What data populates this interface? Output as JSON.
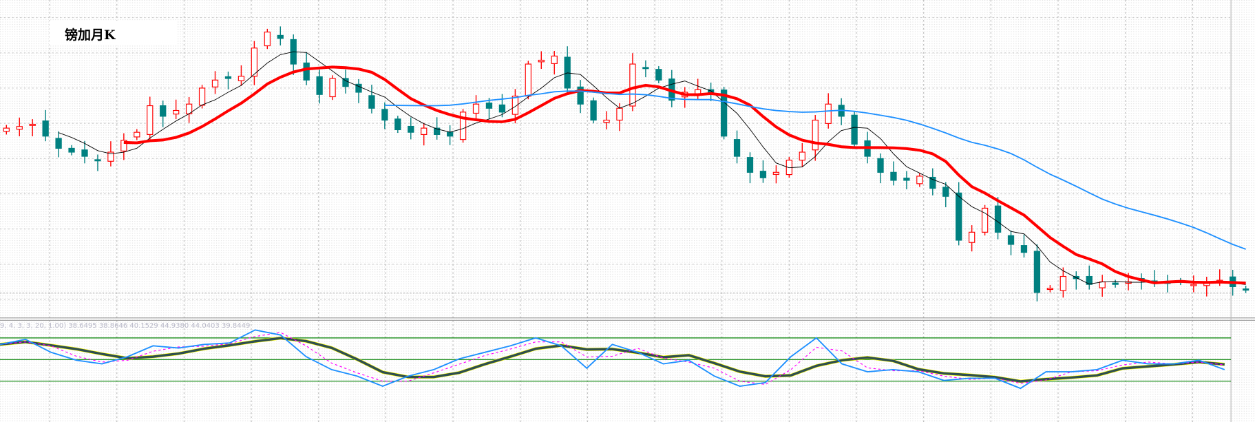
{
  "chart_data": {
    "type": "candlestick",
    "title": "镑加月K",
    "grid": true,
    "colors": {
      "up": "#ff0000",
      "down": "#008080",
      "ma_fast": "#000000",
      "ma_mid": "#ff0000",
      "ma_slow": "#1e90ff",
      "osc_fast": "#1e90ff",
      "osc_signal": "#ff00ff",
      "osc_slow": "#2f4f4f",
      "osc_slow_edge": "#ffff00",
      "levels": "#008000"
    },
    "closes": [
      60,
      60.5,
      61.2,
      57.5,
      53.7,
      52.5,
      51.2,
      50,
      52.5,
      56.2,
      58.7,
      67,
      63.7,
      65.5,
      67.5,
      72.5,
      75,
      75.5,
      76.2,
      85,
      90,
      88,
      80,
      75,
      70.5,
      75.5,
      73,
      71.2,
      66.2,
      62.5,
      59.5,
      58.7,
      60,
      58,
      57.5,
      65,
      67.5,
      66.2,
      65,
      70,
      80,
      81.2,
      82.5,
      72.5,
      67.5,
      62.5,
      62.5,
      66.2,
      80,
      78.7,
      75,
      68.7,
      71.2,
      72,
      71.2,
      57.5,
      51.2,
      46.2,
      44.5,
      46.2,
      50,
      52.5,
      62.5,
      67.5,
      63.7,
      55,
      51.2,
      46.2,
      43.7,
      43.7,
      45,
      41.2,
      38.7,
      25,
      27.5,
      35,
      27.5,
      23.7,
      21.2,
      8.7,
      10,
      13.7,
      13,
      11.2,
      12,
      11.2,
      12,
      13,
      12,
      11.5,
      12,
      11.2,
      12,
      12.5,
      10.5,
      9.5
    ],
    "moving_averages": [
      5,
      10,
      20,
      60
    ],
    "indicator": {
      "label": "9, 4, 3, 3, 20, 1.00) 38.6495 38.8646 40.1529 44.9380 44.0403 39.8449",
      "levels": [
        80,
        50,
        20
      ],
      "range": [
        0,
        100
      ],
      "fast": [
        71,
        78,
        60,
        49,
        44,
        54,
        69,
        66,
        71,
        73,
        91,
        84,
        54,
        36,
        27,
        13,
        27,
        36,
        51,
        60,
        69,
        80,
        69,
        38,
        71,
        60,
        44,
        49,
        27,
        13,
        18,
        54,
        80,
        44,
        33,
        36,
        33,
        21,
        24,
        24,
        10,
        33,
        33,
        36,
        49,
        44,
        44,
        49,
        36
      ]
    }
  }
}
